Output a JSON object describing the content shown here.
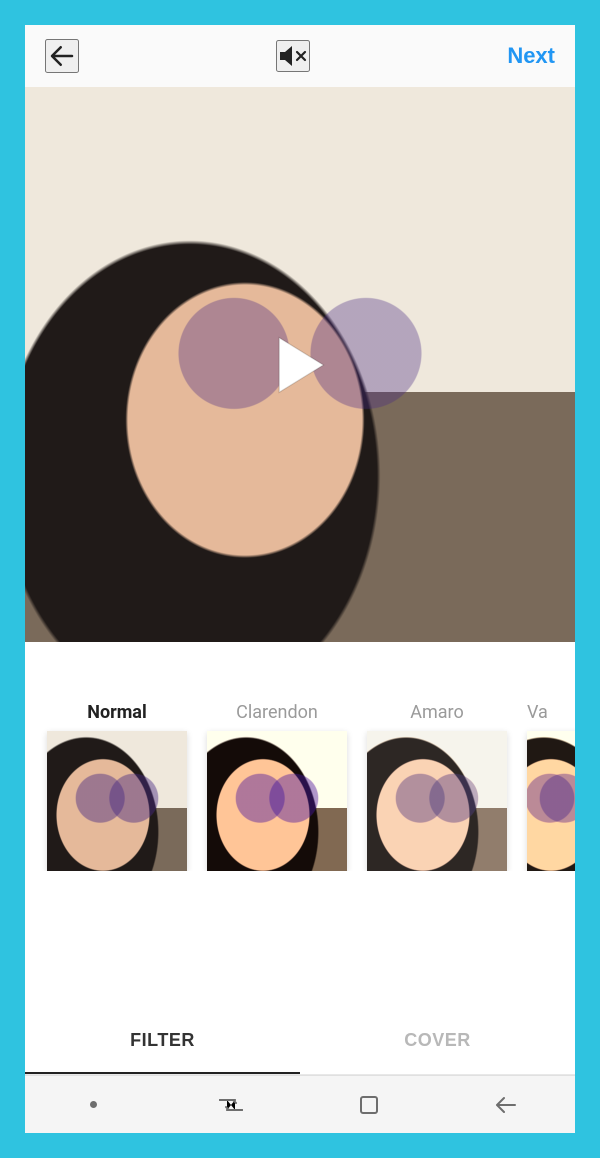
{
  "header": {
    "back_label": "Back",
    "mute_label": "Muted",
    "next_label": "Next"
  },
  "video": {
    "play_label": "Play"
  },
  "filters": {
    "selected_index": 0,
    "items": [
      {
        "label": "Normal",
        "variant": "normal"
      },
      {
        "label": "Clarendon",
        "variant": "clarendon"
      },
      {
        "label": "Amaro",
        "variant": "amaro"
      },
      {
        "label": "Valencia",
        "variant": "valencia"
      }
    ]
  },
  "tabs": {
    "selected_index": 0,
    "items": [
      {
        "label": "FILTER"
      },
      {
        "label": "COVER"
      }
    ]
  },
  "navbar": {
    "items": [
      {
        "name": "nav-dot"
      },
      {
        "name": "nav-recents"
      },
      {
        "name": "nav-crop"
      },
      {
        "name": "nav-back"
      }
    ]
  }
}
